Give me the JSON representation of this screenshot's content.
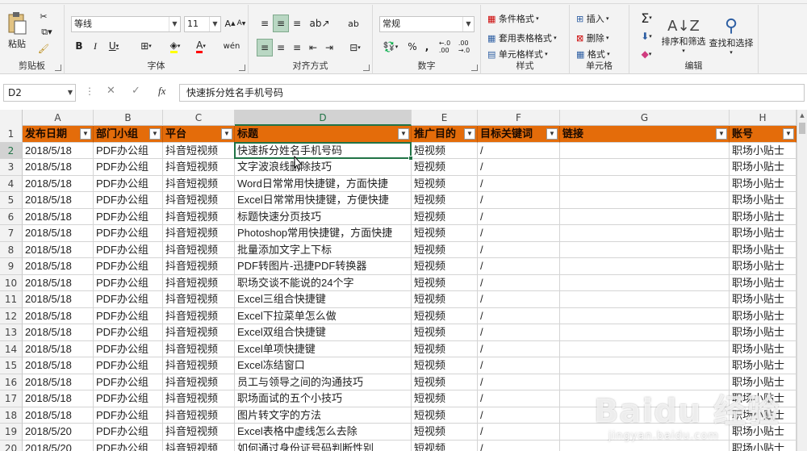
{
  "ribbon": {
    "clipboard": {
      "paste_label": "粘贴",
      "group_label": "剪贴板"
    },
    "font": {
      "font_name": "等线",
      "font_size": "11",
      "group_label": "字体",
      "bold": "B",
      "italic": "I",
      "underline": "U",
      "phonetic": "wén"
    },
    "alignment": {
      "group_label": "对齐方式",
      "wrap": "ab"
    },
    "number": {
      "format": "常规",
      "percent": "%",
      "comma": ",",
      "group_label": "数字"
    },
    "styles": {
      "conditional": "条件格式",
      "table": "套用表格格式",
      "cell": "单元格样式",
      "group_label": "样式"
    },
    "cells": {
      "insert": "插入",
      "delete": "删除",
      "format": "格式",
      "group_label": "单元格"
    },
    "editing": {
      "sort_filter": "排序和筛选",
      "find_select": "查找和选择",
      "group_label": "编辑"
    }
  },
  "formula_bar": {
    "name_box": "D2",
    "fx": "fx",
    "content": "快速拆分姓名手机号码"
  },
  "columns": [
    "A",
    "B",
    "C",
    "D",
    "E",
    "F",
    "G",
    "H"
  ],
  "active_column": "D",
  "header_row": {
    "row_number": "1",
    "cells": [
      "发布日期",
      "部门小组",
      "平台",
      "标题",
      "推广目的",
      "目标关键词",
      "链接",
      "账号"
    ]
  },
  "rows": [
    {
      "n": "2",
      "cells": [
        "2018/5/18",
        "PDF办公组",
        "抖音短视频",
        "快速拆分姓名手机号码",
        "短视频",
        "/",
        "",
        "职场小贴士"
      ]
    },
    {
      "n": "3",
      "cells": [
        "2018/5/18",
        "PDF办公组",
        "抖音短视频",
        "文字波浪线删除技巧",
        "短视频",
        "/",
        "",
        "职场小贴士"
      ]
    },
    {
      "n": "4",
      "cells": [
        "2018/5/18",
        "PDF办公组",
        "抖音短视频",
        "Word日常常用快捷键，方面快捷",
        "短视频",
        "/",
        "",
        "职场小贴士"
      ]
    },
    {
      "n": "5",
      "cells": [
        "2018/5/18",
        "PDF办公组",
        "抖音短视频",
        "Excel日常常用快捷键，方便快捷",
        "短视频",
        "/",
        "",
        "职场小贴士"
      ]
    },
    {
      "n": "6",
      "cells": [
        "2018/5/18",
        "PDF办公组",
        "抖音短视频",
        "标题快速分页技巧",
        "短视频",
        "/",
        "",
        "职场小贴士"
      ]
    },
    {
      "n": "7",
      "cells": [
        "2018/5/18",
        "PDF办公组",
        "抖音短视频",
        "Photoshop常用快捷键，方面快捷",
        "短视频",
        "/",
        "",
        "职场小贴士"
      ]
    },
    {
      "n": "8",
      "cells": [
        "2018/5/18",
        "PDF办公组",
        "抖音短视频",
        "批量添加文字上下标",
        "短视频",
        "/",
        "",
        "职场小贴士"
      ]
    },
    {
      "n": "9",
      "cells": [
        "2018/5/18",
        "PDF办公组",
        "抖音短视频",
        "PDF转图片-迅捷PDF转换器",
        "短视频",
        "/",
        "",
        "职场小贴士"
      ]
    },
    {
      "n": "10",
      "cells": [
        "2018/5/18",
        "PDF办公组",
        "抖音短视频",
        "职场交谈不能说的24个字",
        "短视频",
        "/",
        "",
        "职场小贴士"
      ]
    },
    {
      "n": "11",
      "cells": [
        "2018/5/18",
        "PDF办公组",
        "抖音短视频",
        "Excel三组合快捷键",
        "短视频",
        "/",
        "",
        "职场小贴士"
      ]
    },
    {
      "n": "12",
      "cells": [
        "2018/5/18",
        "PDF办公组",
        "抖音短视频",
        "Excel下拉菜单怎么做",
        "短视频",
        "/",
        "",
        "职场小贴士"
      ]
    },
    {
      "n": "13",
      "cells": [
        "2018/5/18",
        "PDF办公组",
        "抖音短视频",
        "Excel双组合快捷键",
        "短视频",
        "/",
        "",
        "职场小贴士"
      ]
    },
    {
      "n": "14",
      "cells": [
        "2018/5/18",
        "PDF办公组",
        "抖音短视频",
        "Excel单项快捷键",
        "短视频",
        "/",
        "",
        "职场小贴士"
      ]
    },
    {
      "n": "15",
      "cells": [
        "2018/5/18",
        "PDF办公组",
        "抖音短视频",
        "Excel冻结窗口",
        "短视频",
        "/",
        "",
        "职场小贴士"
      ]
    },
    {
      "n": "16",
      "cells": [
        "2018/5/18",
        "PDF办公组",
        "抖音短视频",
        "员工与领导之间的沟通技巧",
        "短视频",
        "/",
        "",
        "职场小贴士"
      ]
    },
    {
      "n": "17",
      "cells": [
        "2018/5/18",
        "PDF办公组",
        "抖音短视频",
        "职场面试的五个小技巧",
        "短视频",
        "/",
        "",
        "职场小贴士"
      ]
    },
    {
      "n": "18",
      "cells": [
        "2018/5/18",
        "PDF办公组",
        "抖音短视频",
        "图片转文字的方法",
        "短视频",
        "/",
        "",
        "职场小贴士"
      ]
    },
    {
      "n": "19",
      "cells": [
        "2018/5/20",
        "PDF办公组",
        "抖音短视频",
        "Excel表格中虚线怎么去除",
        "短视频",
        "/",
        "",
        "职场小贴士"
      ]
    },
    {
      "n": "20",
      "cells": [
        "2018/5/20",
        "PDF办公组",
        "抖音短视频",
        "如何通过身份证号码判断性别",
        "短视频",
        "/",
        "",
        "职场小贴士"
      ]
    }
  ],
  "watermark": {
    "main": "Baidu 经验",
    "sub": "jingyan.baidu.com"
  },
  "colors": {
    "header_fill": "#e46c0a",
    "excel_green": "#217346"
  }
}
